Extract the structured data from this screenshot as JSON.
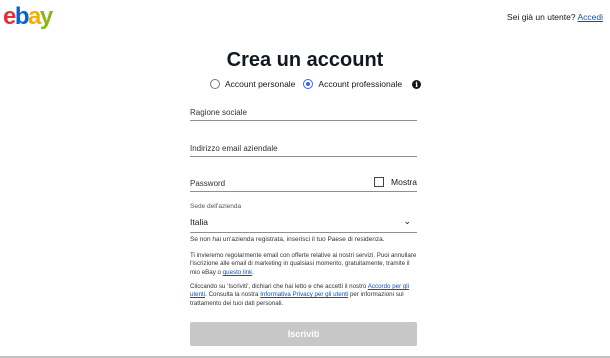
{
  "header": {
    "logo": [
      "e",
      "b",
      "a",
      "y"
    ],
    "logo_colors": [
      "#e53238",
      "#0064d2",
      "#f5af02",
      "#86b817"
    ],
    "signin_prompt": "Sei già un utente?",
    "signin_link": "Accedi"
  },
  "form": {
    "title": "Crea un account",
    "account_types": {
      "personal": "Account personale",
      "business": "Account professionale",
      "selected": "business",
      "info_icon": "i"
    },
    "company_name_placeholder": "Ragione sociale",
    "business_email_placeholder": "Indirizzo email aziendale",
    "password_placeholder": "Password",
    "show_password_label": "Mostra",
    "country": {
      "label": "Sede dell'azienda",
      "value": "Italia",
      "chevron": "⌄",
      "help": "Se non hai un'azienda registrata, inserisci il tuo Paese di residenza."
    },
    "marketing_text": "Ti invieremo regolarmente email con offerte relative ai nostri servizi. Puoi annullare l'iscrizione alle email di marketing in qualsiasi momento, gratuitamente, tramite il mio eBay o",
    "marketing_link": "questo link",
    "marketing_end": ".",
    "terms_prefix": "Cliccando su 'Iscriviti', dichiari che hai letto e che accetti il nostro",
    "terms_link": "Accordo per gli utenti",
    "terms_middle": ". Consulta la nostra",
    "privacy_link": "Informativa Privacy per gli utenti",
    "terms_suffix": "per informazioni sul trattamento dei tuoi dati personali.",
    "submit_label": "Iscriviti"
  },
  "colors": {
    "accent_blue": "#3665f3",
    "link_blue": "#0654ba",
    "disabled_button": "#c7c7c7"
  }
}
